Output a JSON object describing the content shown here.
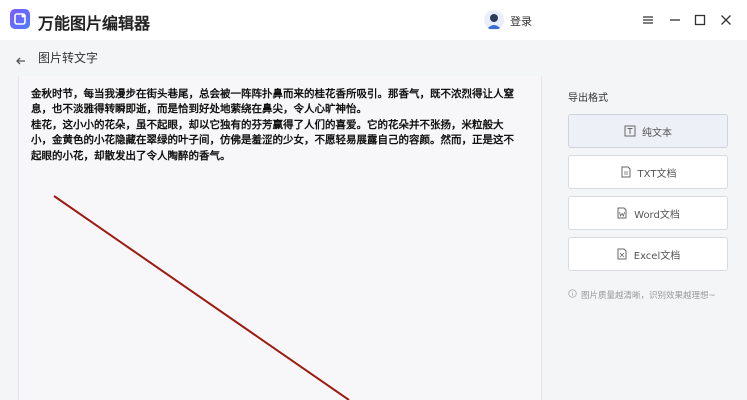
{
  "app": {
    "title": "万能图片编辑器",
    "login": "登录"
  },
  "subheader": {
    "title": "图片转文字"
  },
  "content": {
    "paragraphs": [
      "金秋时节，每当我漫步在街头巷尾，总会被一阵阵扑鼻而来的桂花香所吸引。那香气，既不浓烈得让人窒息，也不淡雅得转瞬即逝，而是恰到好处地萦绕在鼻尖，令人心旷神怡。",
      "桂花，这小小的花朵，虽不起眼，却以它独有的芬芳赢得了人们的喜爱。它的花朵并不张扬，米粒般大小，金黄色的小花隐藏在翠绿的叶子间，仿佛是羞涩的少女，不愿轻易展露自己的容颜。然而，正是这不起眼的小花，却散发出了令人陶醉的香气。"
    ]
  },
  "export": {
    "title": "导出格式",
    "options": [
      {
        "label": "纯文本",
        "icon": "text-t-icon"
      },
      {
        "label": "TXT文档",
        "icon": "txt-doc-icon"
      },
      {
        "label": "Word文档",
        "icon": "word-doc-icon"
      },
      {
        "label": "Excel文档",
        "icon": "excel-doc-icon"
      }
    ],
    "hint": "图片质量越清晰，识别效果越理想~"
  },
  "colors": {
    "accent": "#6a5cff",
    "annotation_line": "#9b1b12"
  }
}
